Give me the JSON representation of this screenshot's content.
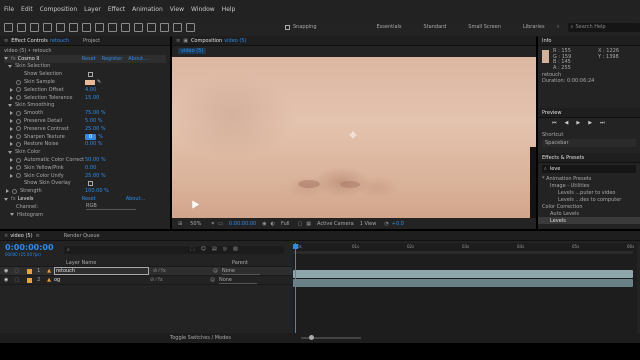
{
  "menu": [
    "File",
    "Edit",
    "Composition",
    "Layer",
    "Effect",
    "Animation",
    "View",
    "Window",
    "Help"
  ],
  "toolbar": {
    "snapping": "Snapping",
    "workspaces": [
      "Essentials",
      "Standard",
      "Small Screen",
      "Libraries"
    ],
    "search_placeholder": "Search Help"
  },
  "effect_controls": {
    "tab_label": "Effect Controls",
    "tab_target": "retouch",
    "project_tab": "Project",
    "breadcrumb": "video (5) • retouch",
    "effect_name": "Cosmo II",
    "reset": "Reset",
    "register": "Register",
    "about": "About...",
    "skin_selection": "Skin Selection",
    "show_selection": "Show Selection",
    "skin_sample": "Skin Sample",
    "selection_offset": "Selection Offset",
    "selection_offset_val": "4.00",
    "selection_tolerance": "Selection Tolerance",
    "selection_tolerance_val": "15.00",
    "skin_smoothing": "Skin Smoothing",
    "smooth": "Smooth",
    "smooth_val": "75.00 %",
    "preserve_detail": "Preserve Detail",
    "preserve_detail_val": "5.00 %",
    "preserve_contrast": "Preserve Contrast",
    "preserve_contrast_val": "25.00 %",
    "sharpen_texture": "Sharpen Texture",
    "sharpen_texture_val": "0",
    "sharpen_unit": "%",
    "restore_noise": "Restore Noise",
    "restore_noise_val": "0.00 %",
    "skin_color": "Skin Color",
    "auto_color_correct": "Automatic Color Correct",
    "auto_color_correct_val": "50.00 %",
    "skin_yellow_pink": "Skin Yellow/Pink",
    "skin_yellow_pink_val": "0.00",
    "skin_color_unify": "Skin Color Unify",
    "skin_color_unify_val": "25.00 %",
    "show_skin_overlay": "Show Skin Overlay",
    "strength": "Strength",
    "strength_val": "100.00 %",
    "levels": "Levels",
    "levels_reset": "Reset",
    "levels_about": "About...",
    "channel": "Channel:",
    "channel_val": "RGB",
    "histogram": "Histogram"
  },
  "composition": {
    "tab_label": "Composition",
    "tab_target": "video (5)",
    "subtab": "video (5)",
    "zoom": "50%",
    "timecode": "0:00:00:00",
    "resolution": "Full",
    "camera": "Active Camera",
    "views": "1 View",
    "exposure": "+0.0"
  },
  "info": {
    "title": "Info",
    "r": "R : 155",
    "g": "G : 159",
    "b": "B : 145",
    "a": "A : 255",
    "x": "X : 1226",
    "y": "Y : 1398",
    "sample_color": "#d1b199",
    "layer": "retouch",
    "duration": "Duration: 0:00:06:24"
  },
  "preview": {
    "title": "Preview"
  },
  "shortcut": {
    "label": "Shortcut",
    "value": "Spacebar"
  },
  "effects_presets": {
    "title": "Effects & Presets",
    "search": "leve",
    "tree": [
      {
        "label": "* Animation Presets",
        "level": 0
      },
      {
        "label": "Image - Utilities",
        "level": 1
      },
      {
        "label": "Levels ...puter to video",
        "level": 2
      },
      {
        "label": "Levels ...des to computer",
        "level": 2
      },
      {
        "label": "Color Correction",
        "level": 0
      },
      {
        "label": "Auto Levels",
        "level": 1
      },
      {
        "label": "Levels",
        "level": 1
      }
    ]
  },
  "timeline": {
    "tab_label": "video (5)",
    "render_queue": "Render Queue",
    "timecode": "0:00:00:00",
    "frame_info": "00000 (25.00 fps)",
    "layer_name_header": "Layer Name",
    "parent_header": "Parent",
    "layers": [
      {
        "num": "1",
        "name": "retouch",
        "parent": "None"
      },
      {
        "num": "2",
        "name": "og",
        "parent": "None"
      }
    ],
    "ruler": [
      "0s",
      "01s",
      "02s",
      "03s",
      "04s",
      "05s",
      "06s"
    ],
    "toggle": "Toggle Switches / Modes"
  },
  "colors": {
    "accent": "#2d8ceb",
    "panel": "#232323",
    "layer_label": "#e8a33a",
    "track": "#8fa6ad"
  }
}
